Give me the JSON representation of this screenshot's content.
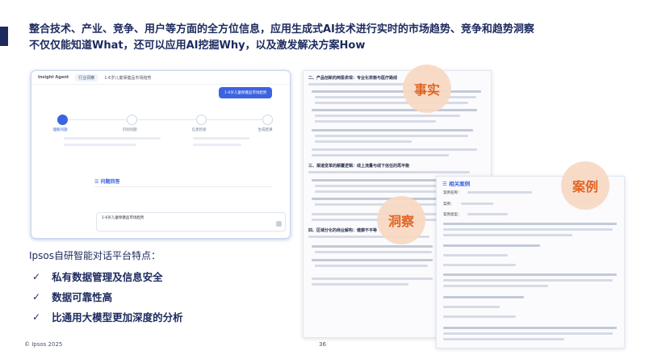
{
  "headline": {
    "line1": "整合技术、产业、竞争、用户等方面的全方位信息，应用生成式AI技术进行实时的市场趋势、竞争和趋势洞察",
    "line2": "不仅仅能知道What，还可以应用AI挖掘Why，以及激发解决方案How"
  },
  "app": {
    "brand": "Insight Agent",
    "tab": "行业洞察",
    "crumb": "1-6岁儿童保健品市场趋势",
    "chat_bubble": "1-6岁儿童保健品市场趋势",
    "steps": [
      "理解问题",
      "识别问题",
      "信息检索",
      "生成结果"
    ],
    "qa_title": "问题回答",
    "input_text": "1-6岁儿童保健品市场趋势"
  },
  "features": {
    "title": "Ipsos自研智能对话平台特点：",
    "check_glyph": "✓",
    "items": [
      "私有数据管理及信息安全",
      "数据可靠性高",
      "比通用大模型更加深度的分析"
    ]
  },
  "doc1": {
    "headings": [
      "二、产品创新的两极表现：专业化表衡与医疗路线",
      "三、渠道变革的颠覆逻辑：线上流量与线下信任的再平衡",
      "四、区域分化的商业解构：健康不平等"
    ]
  },
  "doc2": {
    "title": "相关案例",
    "labels": [
      "案例名称：",
      "案例：",
      "案例类型："
    ]
  },
  "bubbles": {
    "fact": "事实",
    "insight": "洞察",
    "case": "案例"
  },
  "footer": {
    "copyright": "© Ipsos 2025",
    "page": "36"
  },
  "colors": {
    "navy": "#1c2a5e",
    "accent_blue": "#3c63e0",
    "bubble_fill": "#f8d9c3",
    "bubble_text": "#e05a14"
  }
}
